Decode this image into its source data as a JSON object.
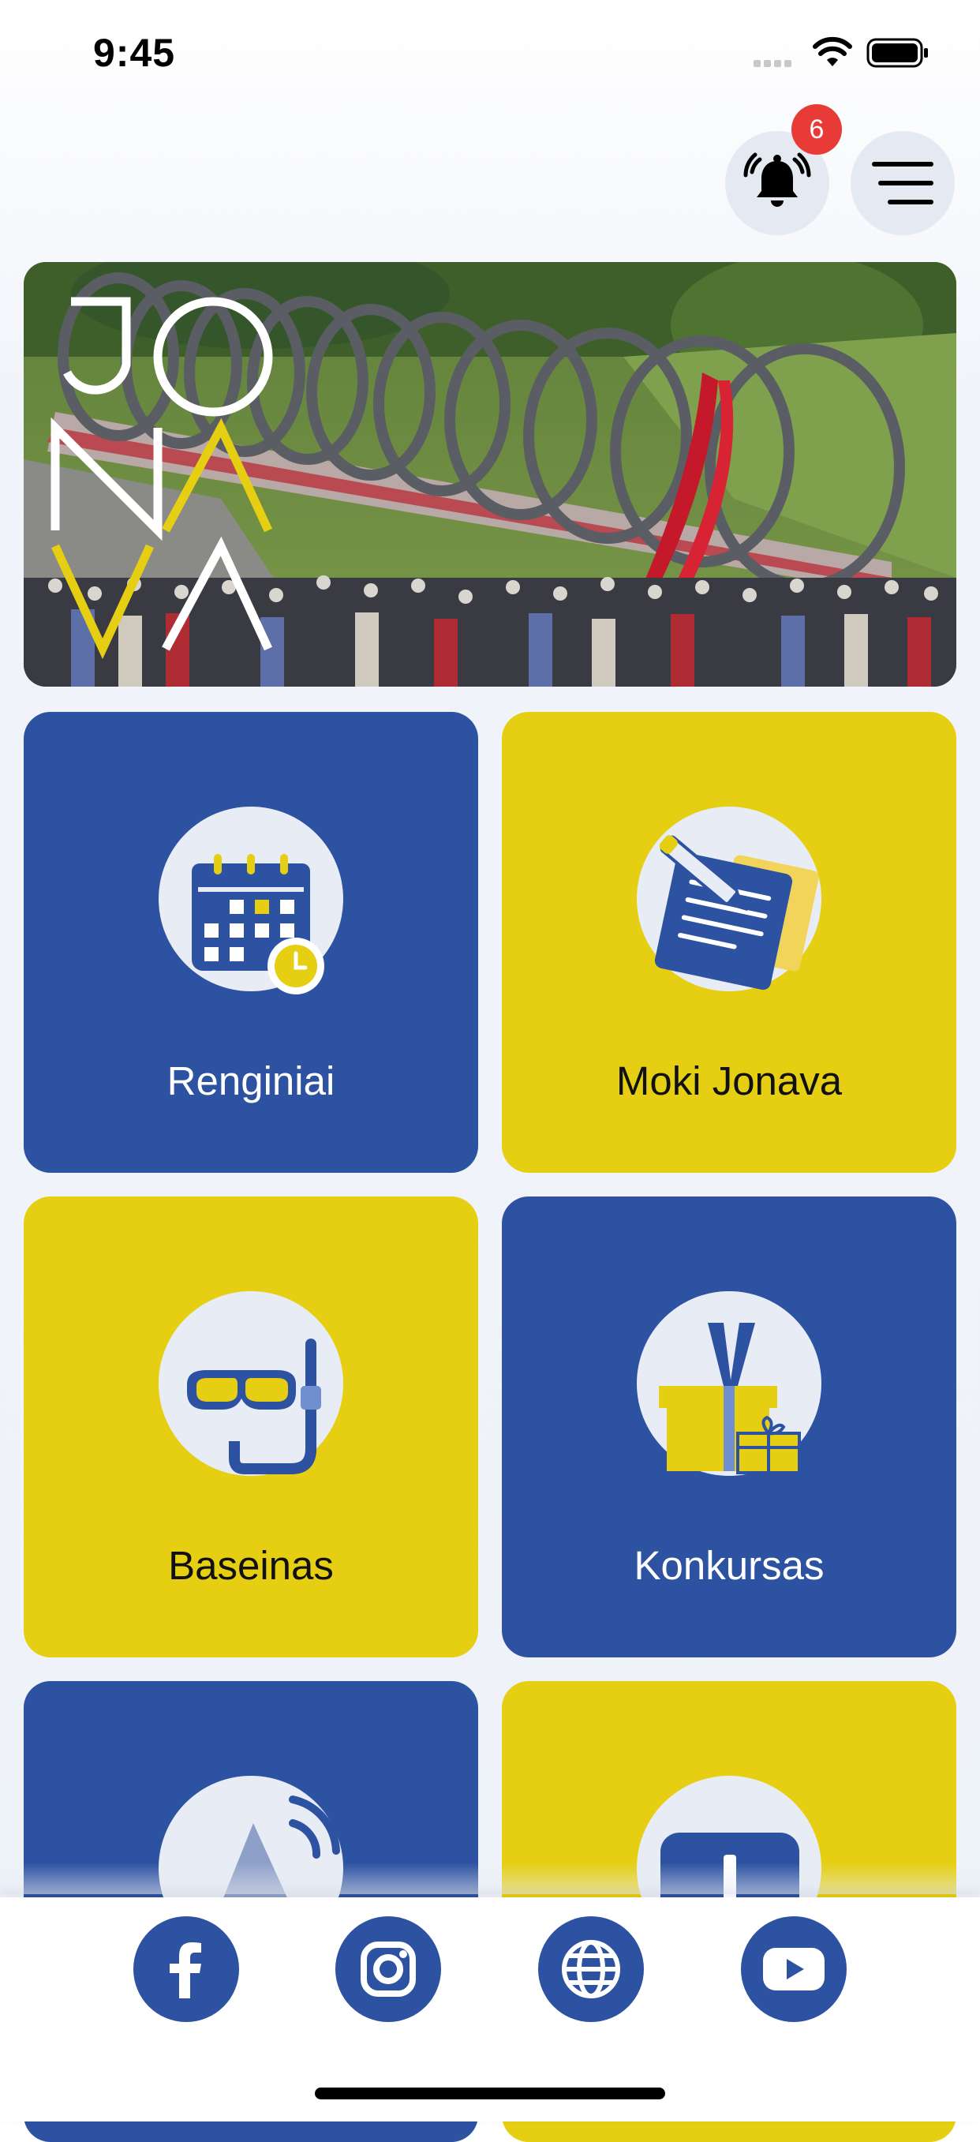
{
  "status": {
    "time": "9:45"
  },
  "header": {
    "notifications_count": "6",
    "bell_icon": "bell-icon",
    "menu_icon": "menu-icon"
  },
  "banner": {
    "logo_letters": [
      "J",
      "O",
      "N",
      "A",
      "V",
      "A"
    ]
  },
  "tiles": [
    {
      "label": "Renginiai",
      "icon": "calendar-icon",
      "color": "blue"
    },
    {
      "label": "Moki Jonava",
      "icon": "note-pencil-icon",
      "color": "yellow"
    },
    {
      "label": "Baseinas",
      "icon": "snorkel-mask-icon",
      "color": "yellow"
    },
    {
      "label": "Konkursas",
      "icon": "gift-icon",
      "color": "blue"
    },
    {
      "label": "",
      "icon": "megaphone-icon",
      "color": "blue"
    },
    {
      "label": "",
      "icon": "info-icon",
      "color": "yellow"
    }
  ],
  "social": [
    {
      "name": "facebook",
      "icon": "facebook-icon"
    },
    {
      "name": "instagram",
      "icon": "instagram-icon"
    },
    {
      "name": "website",
      "icon": "globe-icon"
    },
    {
      "name": "youtube",
      "icon": "youtube-icon"
    }
  ],
  "colors": {
    "blue": "#2d52a1",
    "yellow": "#e6cf12",
    "badge": "#e83b38"
  }
}
